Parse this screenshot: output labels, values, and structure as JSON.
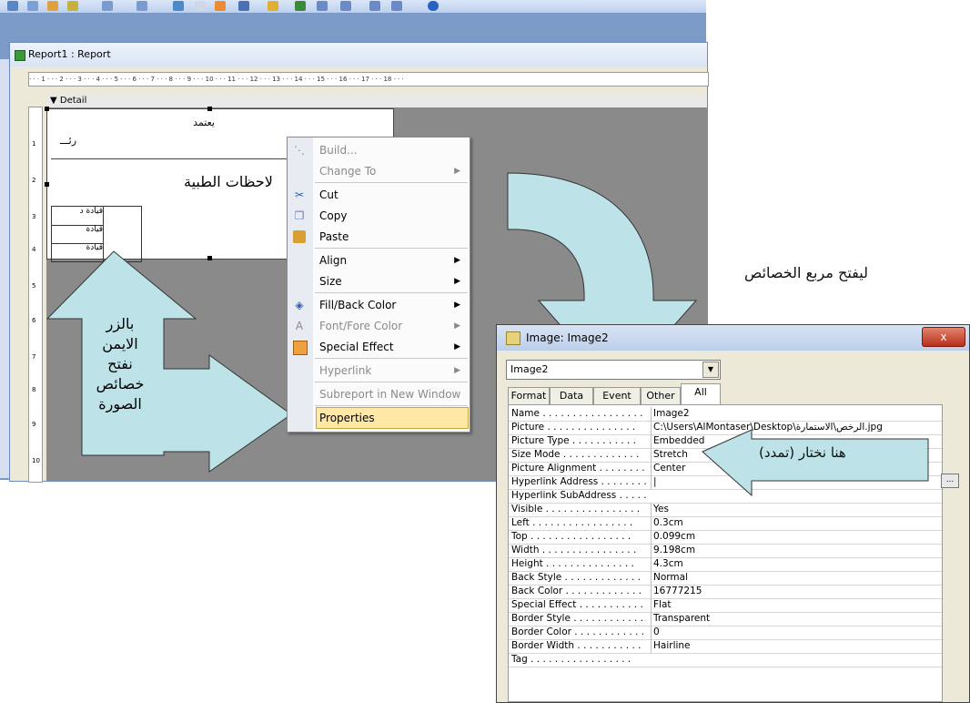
{
  "report_window": {
    "title": "Report1 : Report",
    "section": "Detail",
    "ruler": "· · · 1 · · · 2 · · · 3 · · · 4 · · · 5 · · · 6 · · · 7 · · · 8 · · · 9 · · · 10 · · · 11 · · · 12 · · · 13 · · · 14 · · · 15 · · · 16 · · · 17 · · · 18 · · ·",
    "vruler": [
      "1",
      "2",
      "3",
      "4",
      "5",
      "6",
      "7",
      "8",
      "9",
      "10"
    ]
  },
  "report_content": {
    "text_top": "يعتمد",
    "text_2": "رئـــ",
    "heading": "لاحظات الطبية",
    "rows": [
      "قيادة د",
      "قيادة",
      "قيادة"
    ]
  },
  "context_menu": {
    "items": [
      {
        "label": "Build...",
        "icon": "build-icon",
        "disabled": true
      },
      {
        "label": "Change To",
        "icon": "",
        "disabled": true,
        "submenu": true
      },
      {
        "label": "Cut",
        "icon": "scissors-icon",
        "disabled": false
      },
      {
        "label": "Copy",
        "icon": "copy-icon",
        "disabled": false
      },
      {
        "label": "Paste",
        "icon": "paste-icon",
        "disabled": false
      },
      {
        "label": "Align",
        "icon": "",
        "disabled": false,
        "submenu": true
      },
      {
        "label": "Size",
        "icon": "",
        "disabled": false,
        "submenu": true
      },
      {
        "label": "Fill/Back Color",
        "icon": "fill-color-icon",
        "disabled": false,
        "submenu": true
      },
      {
        "label": "Font/Fore Color",
        "icon": "font-color-icon",
        "disabled": true,
        "submenu": true
      },
      {
        "label": "Special Effect",
        "icon": "special-effect-icon",
        "disabled": false,
        "submenu": true
      },
      {
        "label": "Hyperlink",
        "icon": "",
        "disabled": true,
        "submenu": true
      },
      {
        "label": "Subreport in New Window",
        "icon": "",
        "disabled": true
      },
      {
        "label": "Properties",
        "icon": "",
        "disabled": false,
        "selected": true
      }
    ]
  },
  "property_sheet": {
    "title": "Image: Image2",
    "close": "x",
    "selector_value": "Image2",
    "tabs": [
      "Format",
      "Data",
      "Event",
      "Other",
      "All"
    ],
    "active_tab": "All",
    "ellipsis": "...",
    "rows": [
      {
        "name": "Name . . . . . . . . . . . . . . . . .",
        "value": "Image2"
      },
      {
        "name": "Picture . . . . . . . . . . . . . . .",
        "value": "C:\\Users\\AlMontaser\\Desktop\\الرخص\\الاستمارة.jpg"
      },
      {
        "name": "Picture Type . . . . . . . . . . .",
        "value": "Embedded"
      },
      {
        "name": "Size Mode . . . . . . . . . . . . .",
        "value": "Stretch"
      },
      {
        "name": "Picture Alignment . . . . . . . .",
        "value": "Center"
      },
      {
        "name": "Hyperlink Address . . . . . . . .",
        "value": "|"
      },
      {
        "name": "Hyperlink SubAddress . . . . . .",
        "value": ""
      },
      {
        "name": "Visible . . . . . . . . . . . . . . . .",
        "value": "Yes"
      },
      {
        "name": "Left . . . . . . . . . . . . . . . . .",
        "value": "0.3cm"
      },
      {
        "name": "Top . . . . . . . . . . . . . . . . .",
        "value": "0.099cm"
      },
      {
        "name": "Width . . . . . . . . . . . . . . . .",
        "value": "9.198cm"
      },
      {
        "name": "Height . . . . . . . . . . . . . . .",
        "value": "4.3cm"
      },
      {
        "name": "Back Style . . . . . . . . . . . . .",
        "value": "Normal"
      },
      {
        "name": "Back Color . . . . . . . . . . . . .",
        "value": "16777215"
      },
      {
        "name": "Special Effect . . . . . . . . . . .",
        "value": "Flat"
      },
      {
        "name": "Border Style . . . . . . . . . . . .",
        "value": "Transparent"
      },
      {
        "name": "Border Color . . . . . . . . . . . .",
        "value": "0"
      },
      {
        "name": "Border Width . . . . . . . . . . .",
        "value": "Hairline"
      },
      {
        "name": "Tag . . . . . . . . . . . . . . . . .",
        "value": ""
      }
    ]
  },
  "annotations": {
    "open_properties_note": "ليفتح مربع الخصائص",
    "arrow_left_lines": [
      "بالزر",
      "الايمن",
      "نفتح",
      "خصائص",
      "الصورة"
    ],
    "choose_note": "هنا نختار (تمدد)"
  },
  "colors": {
    "arrow_fill": "#bde3e8",
    "workspace": "#7b9ac6",
    "menu_highlight": "#ffe8a6"
  }
}
